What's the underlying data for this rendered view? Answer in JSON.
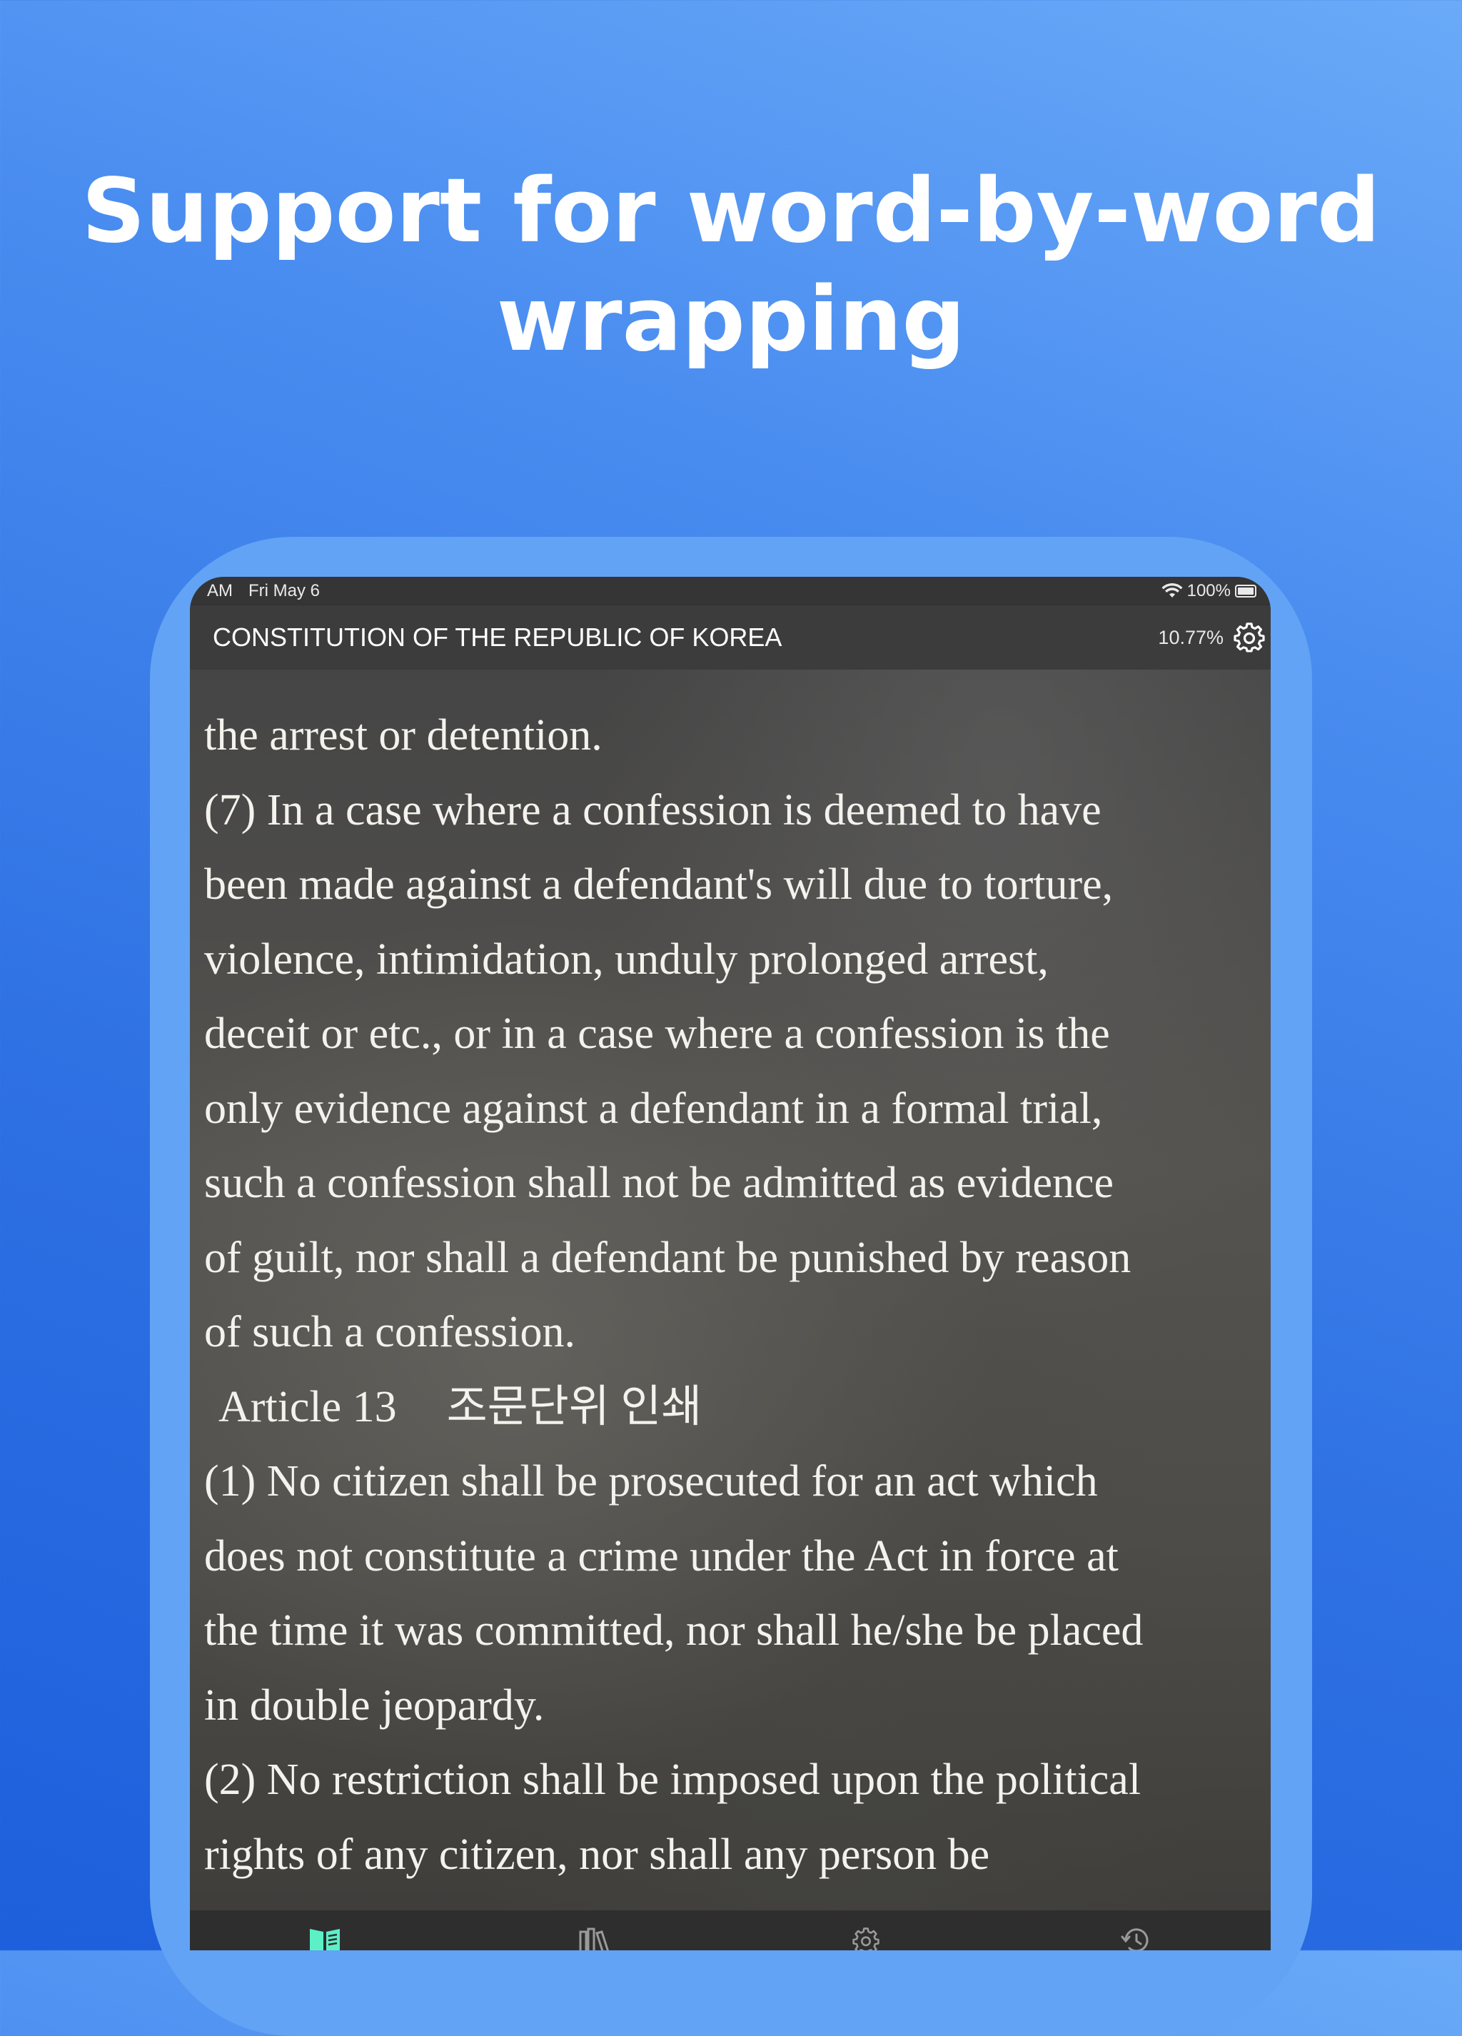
{
  "promo": {
    "headline_line1": "Support for word-by-word",
    "headline_line2": "wrapping",
    "background_top": "#6aaaf8",
    "background_bottom": "#1d5fdc"
  },
  "status_bar": {
    "time": "AM",
    "date": "Fri May 6",
    "battery": "100%",
    "icons": [
      "wifi-icon",
      "battery-icon"
    ]
  },
  "reader": {
    "title": "CONSTITUTION OF THE REPUBLIC OF KOREA",
    "progress": "10.77%",
    "lines": [
      {
        "text": "the arrest or detention."
      },
      {
        "text": "(7) In a case where a confession is deemed to have"
      },
      {
        "text": "been made against a defendant's will due to torture,"
      },
      {
        "text": "violence, intimidation, unduly prolonged arrest,"
      },
      {
        "text": "deceit or etc., or in a case where a confession is the"
      },
      {
        "text": "only evidence against a defendant in a formal trial,"
      },
      {
        "text": "such a confession shall not be admitted as evidence"
      },
      {
        "text": "of guilt, nor shall a defendant be punished by reason"
      },
      {
        "text": "of such a confession."
      },
      {
        "text": "Article 13",
        "korean": "조문단위 인쇄"
      },
      {
        "text": "(1) No citizen shall be prosecuted for an act which"
      },
      {
        "text": "does not constitute a crime under the Act in force at"
      },
      {
        "text": "the time it was committed, nor shall he/she be placed"
      },
      {
        "text": "in double jeopardy."
      },
      {
        "text": "(2) No restriction shall be imposed upon the political"
      },
      {
        "text": "rights of any citizen, nor shall any person be"
      }
    ],
    "play_button_color": "#5cf0c7"
  },
  "tab_bar": {
    "tabs": [
      {
        "icon": "book-open-icon",
        "active": true
      },
      {
        "icon": "library-icon",
        "active": false
      },
      {
        "icon": "gear-icon",
        "active": false
      },
      {
        "icon": "history-icon",
        "active": false
      }
    ],
    "active_color": "#5cf0c7",
    "inactive_color": "#9a9a9a"
  }
}
